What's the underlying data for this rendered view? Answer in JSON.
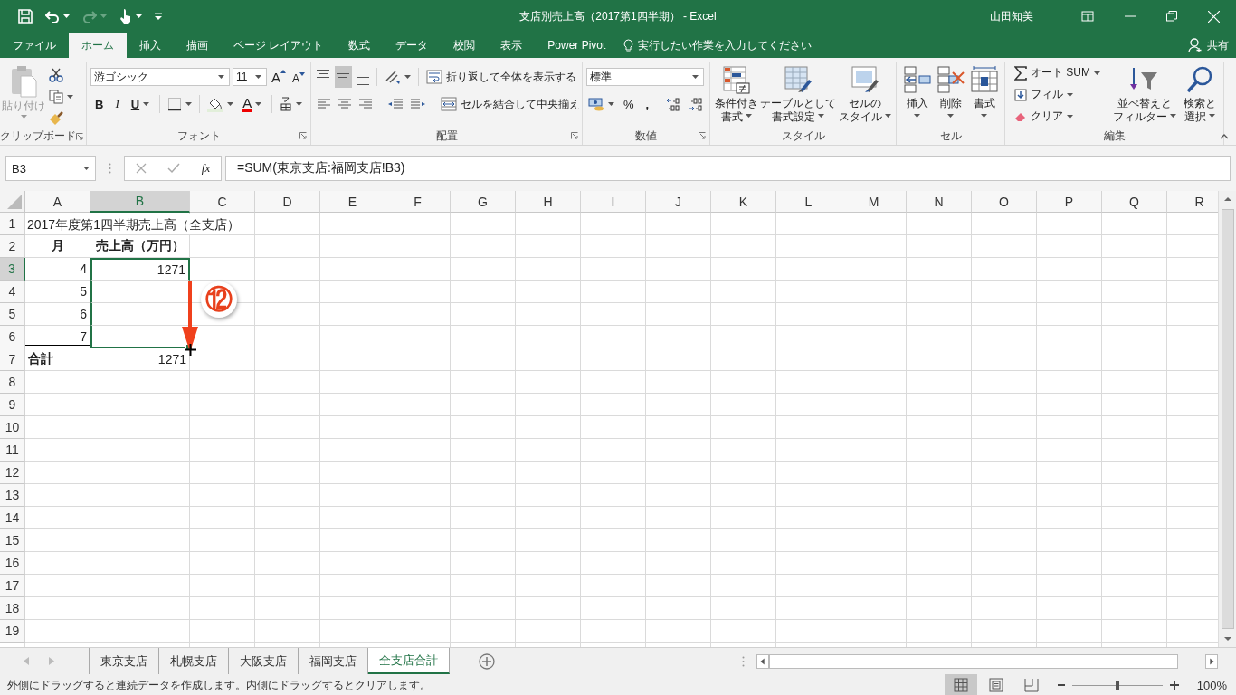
{
  "window": {
    "title": "支店別売上高（2017第1四半期） - Excel",
    "user": "山田知美"
  },
  "ribbon_tabs": [
    {
      "label": "ファイル",
      "selected": false
    },
    {
      "label": "ホーム",
      "selected": true
    },
    {
      "label": "挿入",
      "selected": false
    },
    {
      "label": "描画",
      "selected": false
    },
    {
      "label": "ページ レイアウト",
      "selected": false
    },
    {
      "label": "数式",
      "selected": false
    },
    {
      "label": "データ",
      "selected": false
    },
    {
      "label": "校閲",
      "selected": false
    },
    {
      "label": "表示",
      "selected": false
    },
    {
      "label": "Power Pivot",
      "selected": false
    }
  ],
  "tell_me": {
    "placeholder": "実行したい作業を入力してください"
  },
  "share": {
    "label": "共有"
  },
  "ribbon": {
    "clipboard": {
      "label": "クリップボード",
      "paste": "貼り付け",
      "paste_disabled": true
    },
    "font": {
      "label": "フォント",
      "name": "游ゴシック",
      "size": "11",
      "grow": "A",
      "shrink": "A",
      "bold": "B",
      "italic": "I",
      "underline": "U",
      "color_letter": "A"
    },
    "alignment": {
      "label": "配置",
      "vertical": [
        {
          "selected": false
        },
        {
          "selected": true
        },
        {
          "selected": false
        }
      ],
      "wrap": "折り返して全体を表示する",
      "merge": "セルを結合して中央揃え"
    },
    "number": {
      "label": "数値",
      "format": "標準",
      "percent": "%",
      "comma": ","
    },
    "styles": {
      "label": "スタイル",
      "buttons": [
        {
          "kind": "conditional",
          "lines": [
            "条件付き",
            "書式"
          ]
        },
        {
          "kind": "table",
          "lines": [
            "テーブルとして",
            "書式設定"
          ]
        },
        {
          "kind": "cellstyle",
          "lines": [
            "セルの",
            "スタイル"
          ]
        }
      ]
    },
    "cells": {
      "label": "セル",
      "buttons": [
        {
          "kind": "insert",
          "lines": [
            "挿入"
          ]
        },
        {
          "kind": "delete",
          "lines": [
            "削除"
          ]
        },
        {
          "kind": "format",
          "lines": [
            "書式"
          ]
        }
      ]
    },
    "editing": {
      "label": "編集",
      "autosum": "オート SUM",
      "fill": "フィル",
      "clear": "クリア",
      "buttons": [
        {
          "kind": "sort",
          "lines": [
            "並べ替えと",
            "フィルター"
          ]
        },
        {
          "kind": "find",
          "lines": [
            "検索と",
            "選択"
          ]
        }
      ]
    }
  },
  "formula_bar": {
    "name_box": "B3",
    "fx": "fx",
    "formula": "=SUM(東京支店:福岡支店!B3)"
  },
  "sheet": {
    "columns": [
      {
        "label": "A",
        "selected": false
      },
      {
        "label": "B",
        "selected": true
      },
      {
        "label": "C",
        "selected": false
      },
      {
        "label": "D",
        "selected": false
      },
      {
        "label": "E",
        "selected": false
      },
      {
        "label": "F",
        "selected": false
      },
      {
        "label": "G",
        "selected": false
      },
      {
        "label": "H",
        "selected": false
      },
      {
        "label": "I",
        "selected": false
      },
      {
        "label": "J",
        "selected": false
      },
      {
        "label": "K",
        "selected": false
      },
      {
        "label": "L",
        "selected": false
      },
      {
        "label": "M",
        "selected": false
      },
      {
        "label": "N",
        "selected": false
      },
      {
        "label": "O",
        "selected": false
      },
      {
        "label": "P",
        "selected": false
      },
      {
        "label": "Q",
        "selected": false
      },
      {
        "label": "R",
        "selected": false
      }
    ],
    "rows": [
      {
        "header": "1",
        "selected": false,
        "cells": [
          {
            "text": "2017年度第1四半期売上高（全支店）",
            "kind": "title",
            "selected": false,
            "double_bottom": false
          },
          {
            "kind": "empty",
            "selected": false,
            "double_bottom": false
          }
        ]
      },
      {
        "header": "2",
        "selected": false,
        "cells": [
          {
            "text": "月",
            "kind": "header",
            "selected": false,
            "double_bottom": false
          },
          {
            "text": "売上高（万円）",
            "kind": "header",
            "selected": false,
            "double_bottom": false
          }
        ]
      },
      {
        "header": "3",
        "selected": true,
        "cells": [
          {
            "text": "4",
            "kind": "number",
            "selected": false,
            "double_bottom": false
          },
          {
            "text": "1271",
            "kind": "number",
            "selected": true,
            "double_bottom": false
          }
        ]
      },
      {
        "header": "4",
        "selected": false,
        "cells": [
          {
            "text": "5",
            "kind": "number",
            "selected": false,
            "double_bottom": false
          },
          {
            "kind": "empty",
            "selected": true,
            "double_bottom": false
          }
        ]
      },
      {
        "header": "5",
        "selected": false,
        "cells": [
          {
            "text": "6",
            "kind": "number",
            "selected": false,
            "double_bottom": false
          },
          {
            "kind": "empty",
            "selected": true,
            "double_bottom": false
          }
        ]
      },
      {
        "header": "6",
        "selected": false,
        "cells": [
          {
            "text": "7",
            "kind": "number",
            "selected": false,
            "double_bottom": true
          },
          {
            "kind": "empty",
            "selected": true,
            "double_bottom": false
          }
        ]
      },
      {
        "header": "7",
        "selected": false,
        "cells": [
          {
            "text": "合計",
            "kind": "total",
            "selected": false,
            "double_bottom": false
          },
          {
            "text": "1271",
            "kind": "number",
            "selected": false,
            "double_bottom": false
          }
        ]
      },
      {
        "header": "8",
        "selected": false
      },
      {
        "header": "9",
        "selected": false
      },
      {
        "header": "10",
        "selected": false
      },
      {
        "header": "11",
        "selected": false
      },
      {
        "header": "12",
        "selected": false
      },
      {
        "header": "13",
        "selected": false
      },
      {
        "header": "14",
        "selected": false
      },
      {
        "header": "15",
        "selected": false
      },
      {
        "header": "16",
        "selected": false
      },
      {
        "header": "17",
        "selected": false
      },
      {
        "header": "18",
        "selected": false
      },
      {
        "header": "19",
        "selected": false
      }
    ],
    "annotation": {
      "label": "⑫"
    }
  },
  "sheet_tabs": [
    {
      "label": "東京支店",
      "selected": false
    },
    {
      "label": "札幌支店",
      "selected": false
    },
    {
      "label": "大阪支店",
      "selected": false
    },
    {
      "label": "福岡支店",
      "selected": false
    },
    {
      "label": "全支店合計",
      "selected": true
    }
  ],
  "status_bar": {
    "message": "外側にドラッグすると連続データを作成します。内側にドラッグするとクリアします。",
    "views": [
      {
        "kind": "normal",
        "selected": true
      },
      {
        "kind": "page_layout",
        "selected": false
      },
      {
        "kind": "page_break",
        "selected": false
      }
    ],
    "zoom": {
      "level": 0.5
    },
    "zoom_label": "100%"
  }
}
